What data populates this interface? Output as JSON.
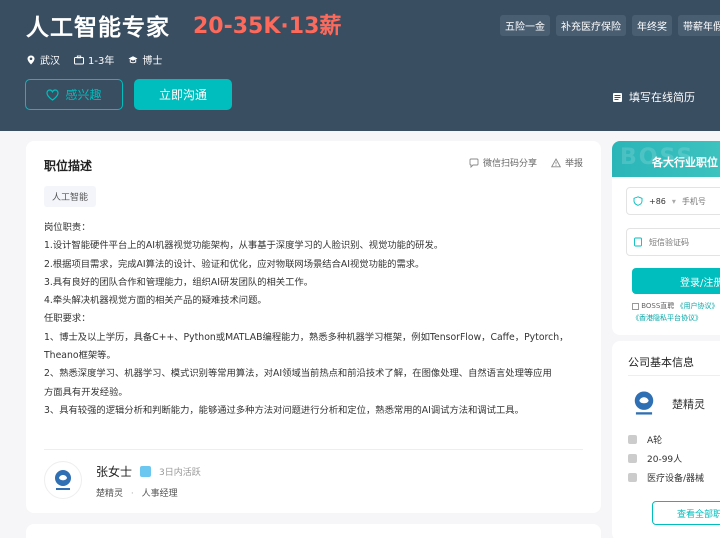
{
  "job": {
    "title": "人工智能专家",
    "salary": "20-35K·13薪",
    "welfare": [
      "五险一金",
      "补充医疗保险",
      "年终奖",
      "带薪年假"
    ],
    "city": "武汉",
    "experience": "1-3年",
    "degree": "博士"
  },
  "buttons": {
    "interest": "感兴趣",
    "chat": "立即沟通",
    "resume": "填写在线简历"
  },
  "description": {
    "title": "职位描述",
    "share": "微信扫码分享",
    "report": "举报",
    "tag": "人工智能",
    "lines": [
      "岗位职责：",
      "1.设计智能硬件平台上的AI机器视觉功能架构，从事基于深度学习的人脸识别、视觉功能的研发。",
      "2.根据项目需求，完成AI算法的设计、验证和优化，应对物联网场景结合AI视觉功能的需求。",
      "3.具有良好的团队合作和管理能力，组织AI研发团队的相关工作。",
      "4.牵头解决机器视觉方面的相关产品的疑难技术问题。",
      "",
      "任职要求：",
      "1、博士及以上学历，具备C++、Python或MATLAB编程能力，熟悉多种机器学习框架，例如TensorFlow，Caffe，Pytorch，",
      "Theano框架等。",
      "2、熟悉深度学习、机器学习、模式识别等常用算法，对AI领域当前热点和前沿技术了解，在图像处理、自然语言处理等应用",
      "方面具有开发经验。",
      "3、具有较强的逻辑分析和判断能力，能够通过多种方法对问题进行分析和定位，熟悉常用的AI调试方法和调试工具。"
    ]
  },
  "recruiter": {
    "name": "张女士",
    "active": "3日内活跃",
    "company": "楚精灵",
    "role": "人事经理",
    "separator": "·"
  },
  "register": {
    "bg_word": "BOSS",
    "title": "各大行业职位",
    "country_code": "+86",
    "phone_placeholder": "手机号",
    "code_placeholder": "短信验证码",
    "login": "登录/注册",
    "agree_line1_prefix": "BOSS直聘",
    "agree_line1_link": "《用户协议》",
    "agree_line2_link": "《香港隐私平台协议》"
  },
  "company": {
    "section_title": "公司基本信息",
    "name": "楚精灵",
    "funding": "A轮",
    "size": "20-99人",
    "industry": "医疗设备/器械",
    "view_all": "查看全部职位"
  },
  "colors": {
    "header_bg": "#3a4e62",
    "accent": "#00bebd",
    "salary": "#fd6a5c"
  }
}
